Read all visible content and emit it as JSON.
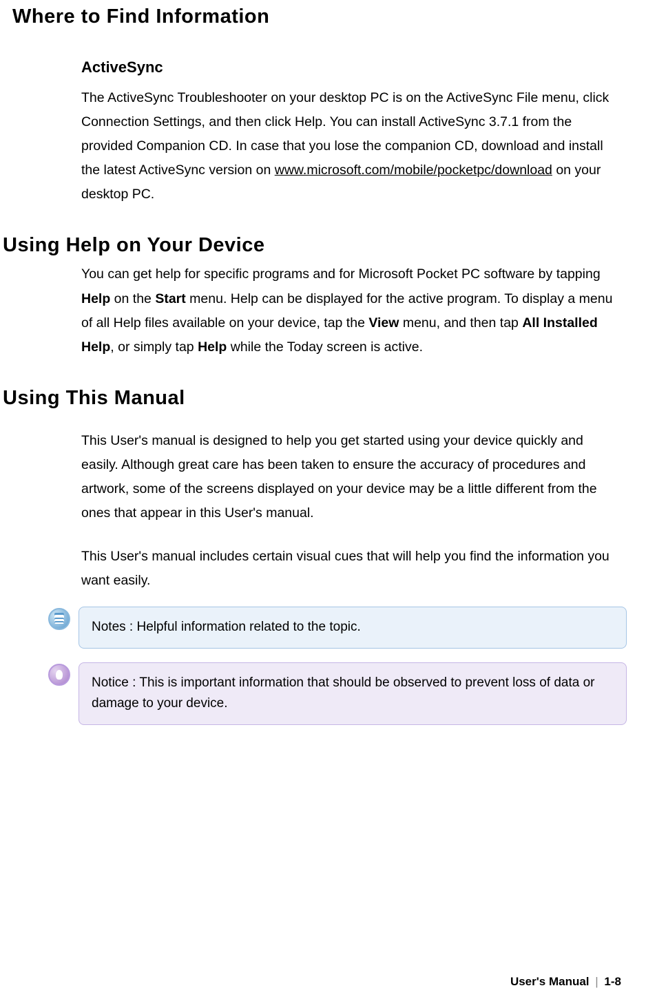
{
  "headings": {
    "main": "Where to Find Information",
    "sub1": "ActiveSync",
    "section2": "Using Help on Your Device",
    "section3": "Using This Manual"
  },
  "activesync": {
    "p1a": "The ActiveSync Troubleshooter on your desktop PC is on the ActiveSync File menu, click Connection Settings, and then click Help. You can install ActiveSync 3.7.1 from the provided Companion CD. In case that you lose the companion CD, download and install the latest ActiveSync version on ",
    "link": "www.microsoft.com/mobile/pocketpc/download",
    "p1b": " on your desktop PC."
  },
  "help_device": {
    "p1a": "You can get help for specific programs and for Microsoft Pocket PC software by tapping ",
    "b1": "Help",
    "p1b": " on the ",
    "b2": "Start",
    "p1c": " menu. Help can be displayed for the active program. To display a menu of all Help files available on your device, tap the ",
    "b3": "View",
    "p1d": " menu, and then tap ",
    "b4": "All Installed Help",
    "p1e": ", or simply tap ",
    "b5": "Help",
    "p1f": " while the Today screen is active."
  },
  "manual": {
    "p1": "This User's manual is designed to help you get started using your device quickly and easily. Although great care has been taken to ensure the accuracy of procedures and artwork, some of the screens displayed on your device may be a little different from the ones that appear in this User's manual.",
    "p2": "This User's manual includes certain visual cues that will help you find the information you want easily."
  },
  "callouts": {
    "notes": "Notes : Helpful information related to the topic.",
    "notice": "Notice : This is important information that should be observed to prevent loss of data or damage to your device."
  },
  "footer": {
    "label": "User's Manual",
    "sep": "|",
    "page": "1-8"
  }
}
